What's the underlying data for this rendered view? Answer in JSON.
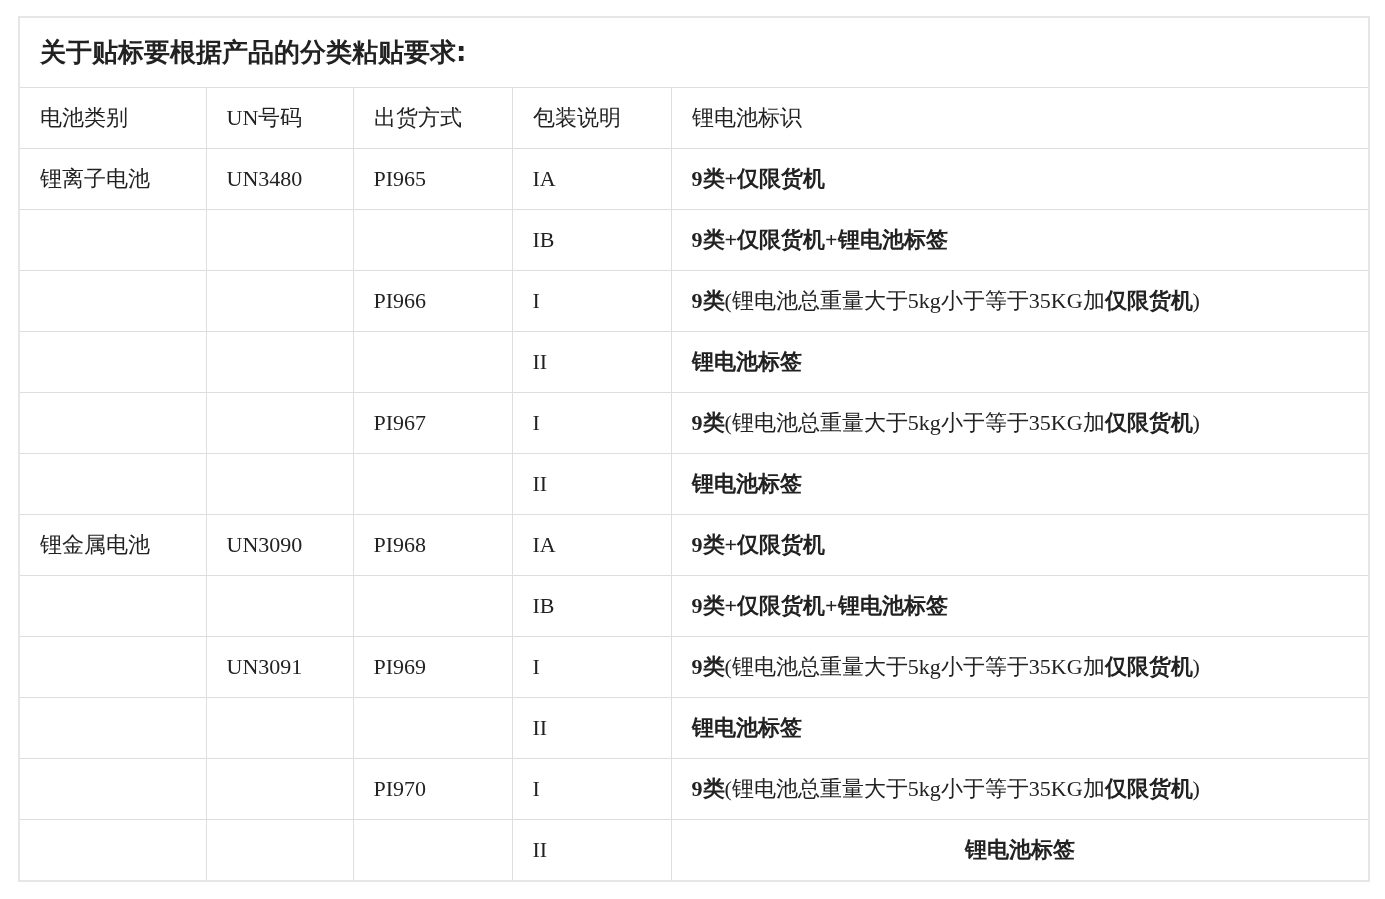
{
  "title": "关于贴标要根据产品的分类粘贴要求:",
  "columns": [
    "电池类别",
    "UN号码",
    "出货方式",
    "包装说明",
    "锂电池标识"
  ],
  "rows": [
    {
      "category": "锂离子电池",
      "un": "UN3480",
      "method": "PI965",
      "packing": "IA",
      "mark": "9类+仅限货机",
      "bold": true,
      "centered": false
    },
    {
      "packing": "IB",
      "mark": "9类+仅限货机+锂电池标签",
      "bold": true,
      "centered": false
    },
    {
      "method": "PI966",
      "packing": "I",
      "mark": "**9类**(锂电池总重量大于5kg小于等于35KG加**仅限货机**)",
      "bold": false,
      "centered": false
    },
    {
      "packing": "II",
      "mark": "锂电池标签",
      "bold": true,
      "centered": false
    },
    {
      "method": "PI967",
      "packing": "I",
      "mark": "**9类**(锂电池总重量大于5kg小于等于35KG加**仅限货机**)",
      "bold": false,
      "centered": false
    },
    {
      "packing": "II",
      "mark": "锂电池标签",
      "bold": true,
      "centered": false
    },
    {
      "category": "锂金属电池",
      "un": "UN3090",
      "method": "PI968",
      "packing": "IA",
      "mark": "9类+仅限货机",
      "bold": true,
      "centered": false
    },
    {
      "packing": "IB",
      "mark": "9类+仅限货机+锂电池标签",
      "bold": true,
      "centered": false
    },
    {
      "un": "UN3091",
      "method": "PI969",
      "packing": "I",
      "mark": "**9类**(锂电池总重量大于5kg小于等于35KG加**仅限货机**)",
      "bold": false,
      "centered": false
    },
    {
      "packing": "II",
      "mark": "锂电池标签",
      "bold": true,
      "centered": false
    },
    {
      "method": "PI970",
      "packing": "I",
      "mark": "**9类**(锂电池总重量大于5kg小于等于35KG加**仅限货机**)",
      "bold": false,
      "centered": false
    },
    {
      "packing": "II",
      "mark": "锂电池标签",
      "bold": true,
      "centered": true
    }
  ]
}
